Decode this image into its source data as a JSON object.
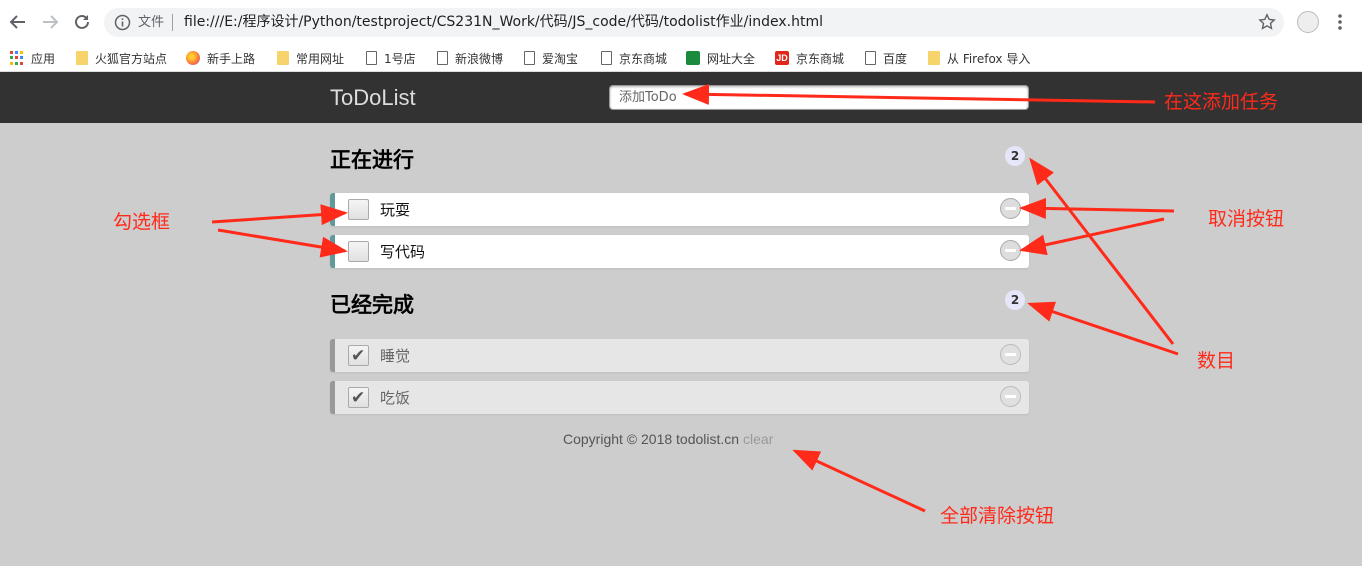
{
  "browser": {
    "scheme_label": "文件",
    "url": "file:///E:/程序设计/Python/testproject/CS231N_Work/代码/JS_code/代码/todolist作业/index.html",
    "bookmarks": [
      {
        "label": "应用",
        "icon": "apps-icon"
      },
      {
        "label": "火狐官方站点",
        "icon": "folder-icon"
      },
      {
        "label": "新手上路",
        "icon": "firefox-icon"
      },
      {
        "label": "常用网址",
        "icon": "folder-icon"
      },
      {
        "label": "1号店",
        "icon": "page-icon"
      },
      {
        "label": "新浪微博",
        "icon": "page-icon"
      },
      {
        "label": "爱淘宝",
        "icon": "page-icon"
      },
      {
        "label": "京东商城",
        "icon": "page-icon"
      },
      {
        "label": "网址大全",
        "icon": "green-site-icon"
      },
      {
        "label": "京东商城",
        "icon": "jd-icon"
      },
      {
        "label": "百度",
        "icon": "page-icon"
      },
      {
        "label": "从 Firefox 导入",
        "icon": "folder-icon"
      }
    ],
    "jd_glyph": "JD"
  },
  "app": {
    "title": "ToDoList",
    "input_placeholder": "添加ToDo"
  },
  "doing": {
    "title": "正在进行",
    "count": "2",
    "items": [
      {
        "text": "玩耍"
      },
      {
        "text": "写代码"
      }
    ]
  },
  "done": {
    "title": "已经完成",
    "count": "2",
    "tick": "✔",
    "items": [
      {
        "text": "睡觉"
      },
      {
        "text": "吃饭"
      }
    ]
  },
  "footer": {
    "copyright": "Copyright © 2018 todolist.cn ",
    "clear_label": "clear"
  },
  "annotations": {
    "add_task": "在这添加任务",
    "checkbox": "勾选框",
    "cancel_button": "取消按钮",
    "count": "数目",
    "clear_all": "全部清除按钮"
  },
  "colors": {
    "header_bg": "#323232",
    "page_bg": "#cdcdcd",
    "doing_accent": "#629a9c",
    "done_accent": "#999999",
    "annotation": "#ff2a1a",
    "badge_bg": "#e6e6fa"
  }
}
